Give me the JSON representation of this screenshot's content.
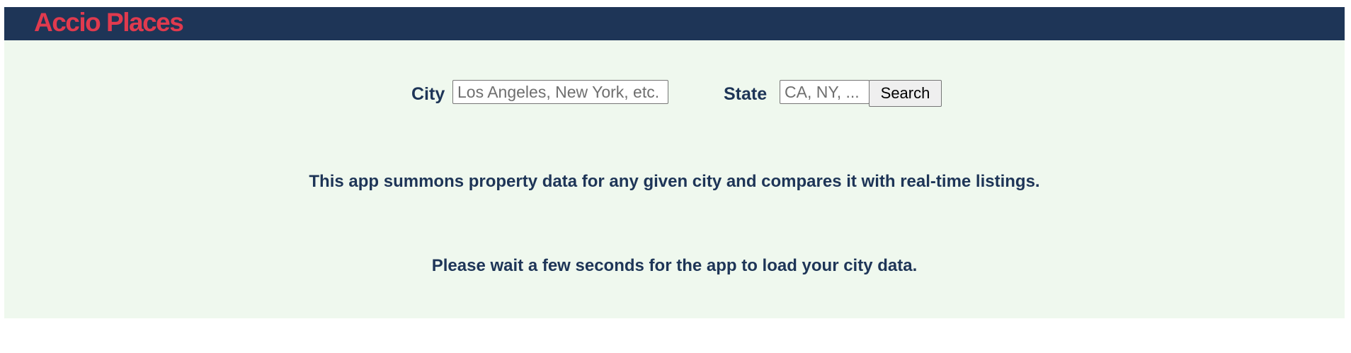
{
  "header": {
    "brand": "Accio Places"
  },
  "search": {
    "city_label": "City",
    "city_placeholder": "Los Angeles, New York, etc.",
    "city_value": "",
    "state_label": "State",
    "state_placeholder": "CA, NY, ...",
    "state_value": "",
    "button_label": "Search"
  },
  "messages": {
    "intro": "This app summons property data for any given city and compares it with real-time listings.",
    "loading": "Please wait a few seconds for the app to load your city data."
  },
  "colors": {
    "header_bg": "#1e3557",
    "brand": "#e03a4e",
    "panel_bg": "#eff8ee",
    "text": "#1e3557"
  }
}
